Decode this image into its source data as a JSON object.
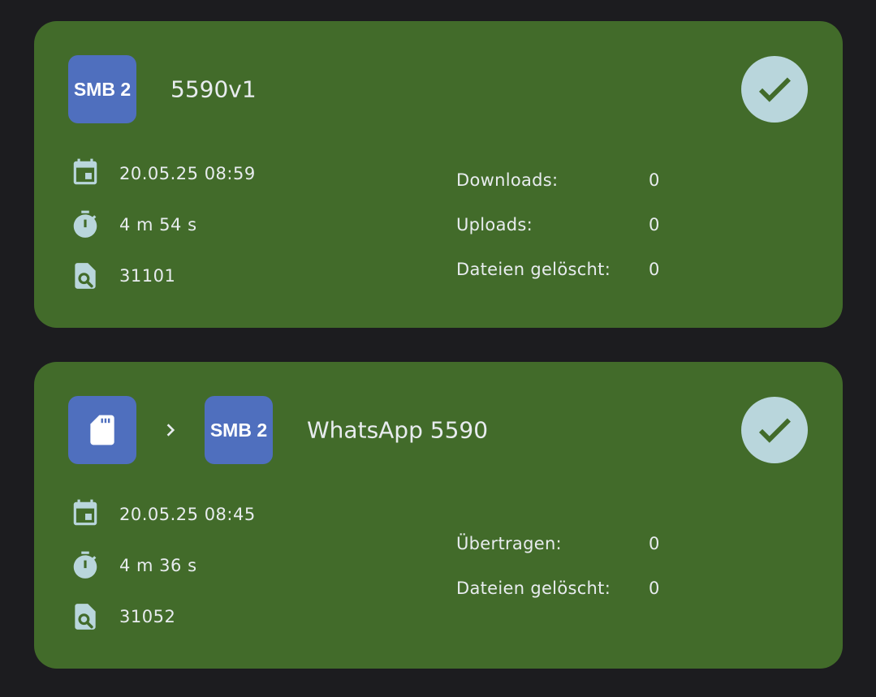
{
  "jobs": [
    {
      "source_badge": "SMB 2",
      "name": "5590v1",
      "status_icon": "check-icon",
      "date": "20.05.25 08:59",
      "duration": "4 m 54 s",
      "files_checked": "31101",
      "stats": [
        {
          "label": "Downloads:",
          "value": "0"
        },
        {
          "label": "Uploads:",
          "value": "0"
        },
        {
          "label": "Dateien gelöscht:",
          "value": "0"
        }
      ]
    },
    {
      "source_icon": "sd-card-icon",
      "target_badge": "SMB 2",
      "name": "WhatsApp 5590",
      "status_icon": "check-icon",
      "date": "20.05.25 08:45",
      "duration": "4 m 36 s",
      "files_checked": "31052",
      "stats": [
        {
          "label": "Übertragen:",
          "value": "0"
        },
        {
          "label": "Dateien gelöscht:",
          "value": "0"
        }
      ]
    }
  ],
  "colors": {
    "background": "#1c1c1f",
    "card": "#426b2a",
    "badge": "#4f6fbe",
    "icon": "#b9d6dc",
    "text": "#e8ecef"
  }
}
